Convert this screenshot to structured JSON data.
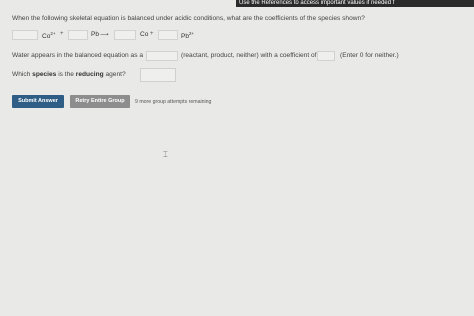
{
  "references_bar": "Use the References to access important values if needed f",
  "question": "When the following skeletal equation is balanced under acidic conditions, what are the coefficients of the species shown?",
  "equation": {
    "species1": "Co",
    "species1_charge": "2+",
    "plus1": "+",
    "species2": "Pb",
    "arrow": "⟶",
    "species3": "Co",
    "plus2": "+",
    "species4": "Pb",
    "species4_charge": "2+"
  },
  "water": {
    "prefix": "Water appears in the balanced equation as a",
    "middle": "(reactant, product, neither) with a coefficient of",
    "suffix": "(Enter 0 for neither.)"
  },
  "reducing": {
    "prefix": "Which ",
    "bold1": "species",
    "middle": " is the ",
    "bold2": "reducing",
    "suffix": " agent?"
  },
  "buttons": {
    "submit": "Submit Answer",
    "retry": "Retry Entire Group"
  },
  "attempts_text": "9 more group attempts remaining"
}
